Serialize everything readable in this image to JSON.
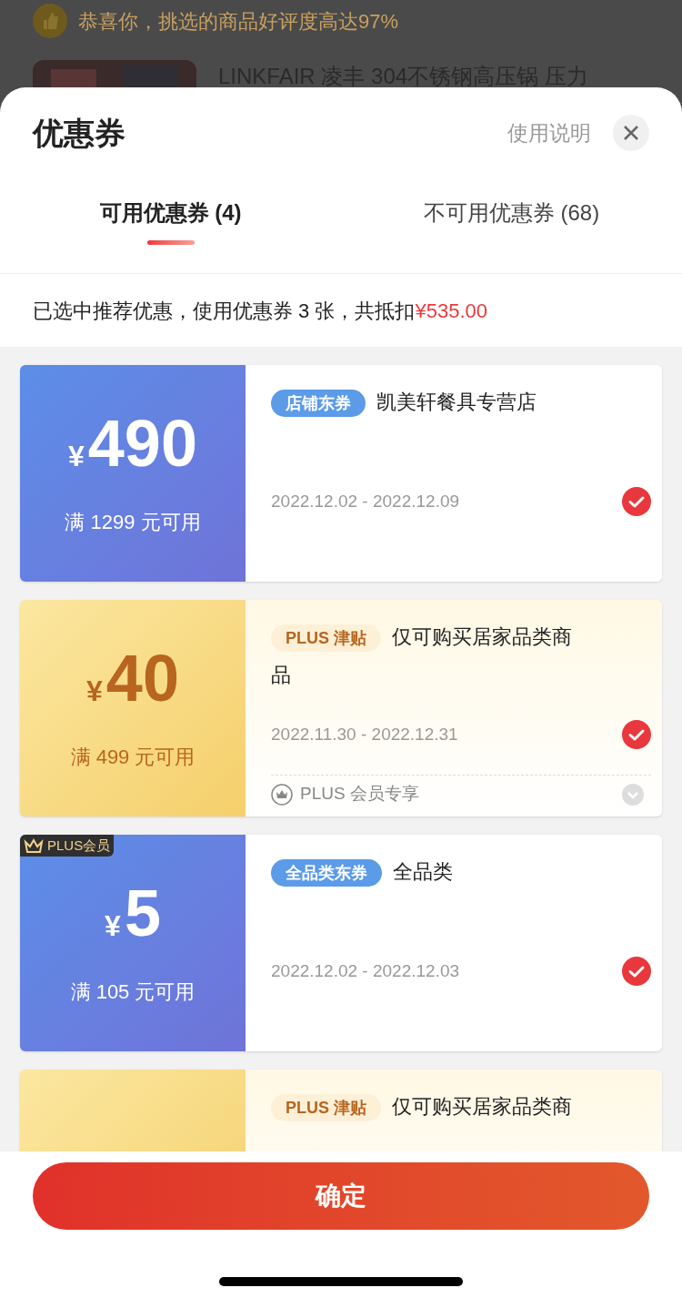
{
  "background": {
    "banner": "恭喜你，挑选的商品好评度高达97%",
    "product_title": "LINKFAIR 凌丰 304不锈钢高压锅 压力"
  },
  "sheet": {
    "title": "优惠券",
    "help_link": "使用说明"
  },
  "tabs": [
    {
      "label": "可用优惠券 (4)",
      "selected": true
    },
    {
      "label": "不可用优惠券 (68)",
      "selected": false
    }
  ],
  "summary": {
    "text": "已选中推荐优惠，使用优惠券 3 张，共抵扣",
    "amount": "¥535.00"
  },
  "coupons": [
    {
      "kind": "store",
      "currency": "¥",
      "amount": "490",
      "condition": "满 1299 元可用",
      "tag": "店铺东券",
      "title": "凯美轩餐具专营店",
      "dates": "2022.12.02 - 2022.12.09",
      "checked": true
    },
    {
      "kind": "plus",
      "currency": "¥",
      "amount": "40",
      "condition": "满 499 元可用",
      "tag": "PLUS 津贴",
      "title": "仅可购买居家品类商品",
      "dates": "2022.11.30 - 2022.12.31",
      "checked": true,
      "footer": "PLUS 会员专享"
    },
    {
      "kind": "store",
      "badge": "PLUS会员",
      "currency": "¥",
      "amount": "5",
      "condition": "满 105 元可用",
      "tag": "全品类东券",
      "title": "全品类",
      "dates": "2022.12.02 - 2022.12.03",
      "checked": true
    },
    {
      "kind": "plus",
      "tag": "PLUS 津贴",
      "title": "仅可购买居家品类商"
    }
  ],
  "confirm_button": "确定"
}
